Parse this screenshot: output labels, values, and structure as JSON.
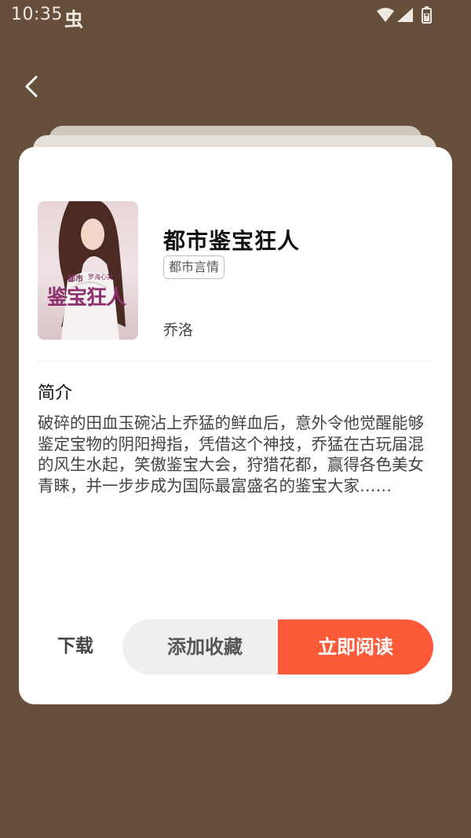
{
  "status_bar": {
    "time": "10:35",
    "bug_glyph": "虫",
    "icons": [
      "wifi-icon",
      "signal-icon",
      "battery-icon"
    ]
  },
  "nav": {
    "back_icon": "chevron-left-icon"
  },
  "book": {
    "title": "都市鉴宝狂人",
    "genre_tag": "都市言情",
    "author": "乔洛",
    "cover": {
      "small_text": "都市",
      "tagline": "罗海心美",
      "big_text": "鉴宝狂人"
    }
  },
  "intro": {
    "heading": "简介",
    "text": "破碎的田血玉碗沾上乔猛的鲜血后，意外令他觉醒能够鉴定宝物的阴阳拇指，凭借这个神技，乔猛在古玩届混的风生水起，笑傲鉴宝大会，狩猎花都，赢得各色美女青睐，并一步步成为国际最富盛名的鉴宝大家……"
  },
  "actions": {
    "download_label": "下载",
    "collect_label": "添加收藏",
    "read_label": "立即阅读"
  },
  "colors": {
    "background": "#66503b",
    "accent": "#fd5a3a",
    "card": "#ffffff"
  }
}
